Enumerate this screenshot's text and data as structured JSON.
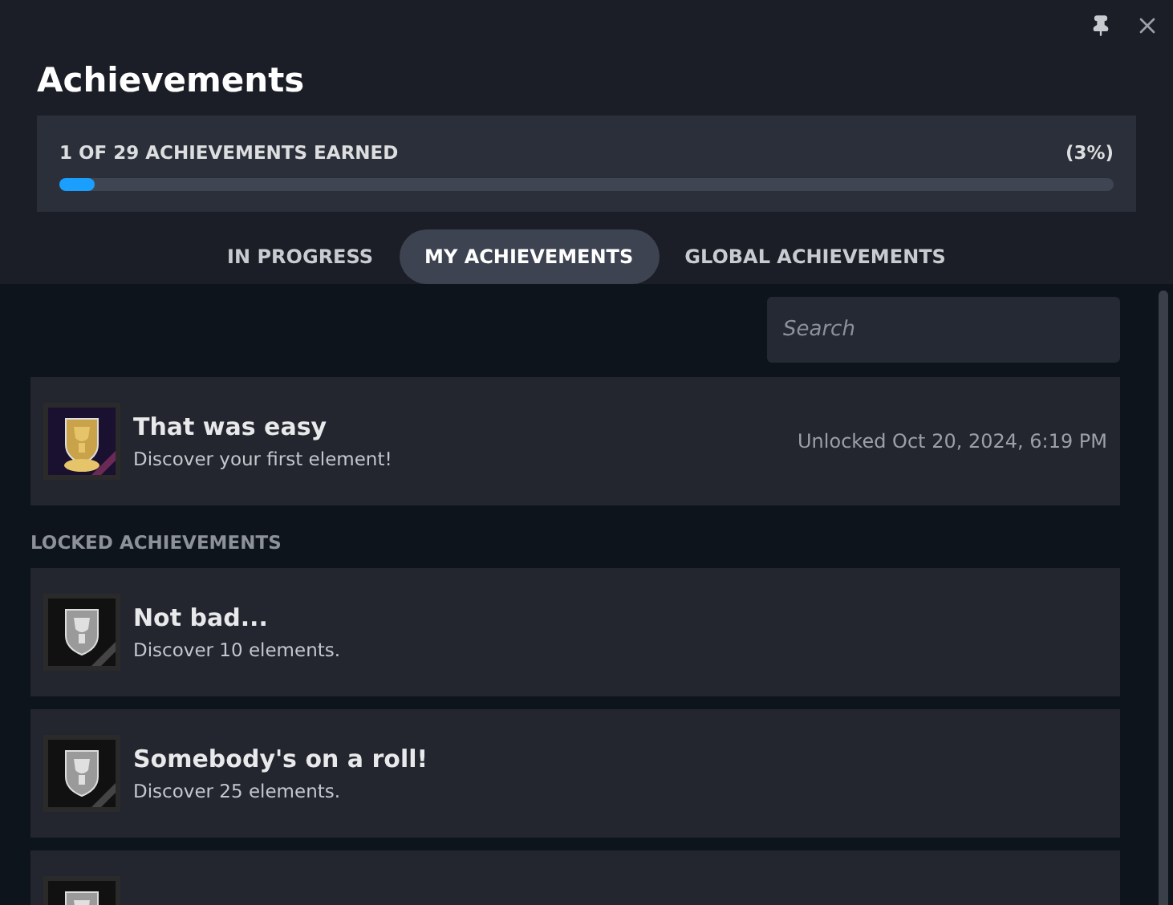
{
  "title": "Achievements",
  "progress": {
    "label": "1 OF 29 ACHIEVEMENTS EARNED",
    "percent": "(3%)",
    "level": 0.034
  },
  "tabs": [
    {
      "label": "IN PROGRESS",
      "selected": false
    },
    {
      "label": "MY ACHIEVEMENTS",
      "selected": true
    },
    {
      "label": "GLOBAL ACHIEVEMENTS",
      "selected": false
    }
  ],
  "search": {
    "placeholder": "Search"
  },
  "unlocked": [
    {
      "name": "That was easy",
      "description": "Discover your first element!",
      "unlocked_at": "Unlocked Oct 20, 2024, 6:19 PM",
      "kind": "gold"
    }
  ],
  "locked_heading": "LOCKED ACHIEVEMENTS",
  "locked": [
    {
      "name": "Not bad...",
      "description": "Discover 10 elements.",
      "kind": "silver"
    },
    {
      "name": "Somebody's on a roll!",
      "description": "Discover 25 elements.",
      "kind": "silver"
    },
    {
      "kind": "silver"
    }
  ]
}
